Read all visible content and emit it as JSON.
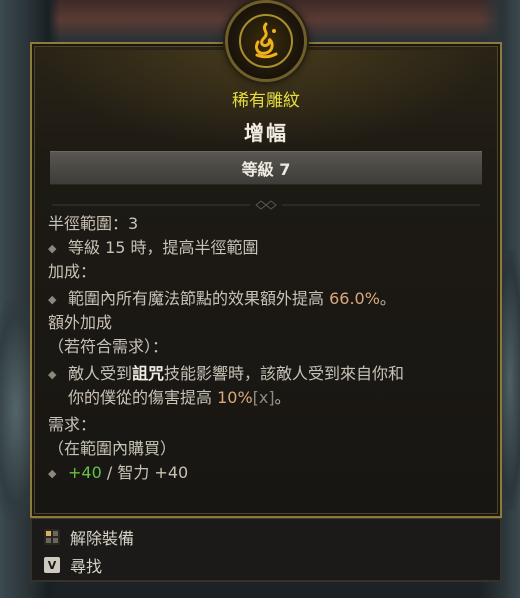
{
  "item": {
    "rarity": "稀有雕紋",
    "name": "增幅",
    "level_label": "等級 7"
  },
  "stats": {
    "radius_label": "半徑範圍：3",
    "radius_bullet": "等級 15 時，提高半徑範圍",
    "bonus_header": "加成：",
    "bonus_text_pre": "範圍內所有魔法節點的效果額外提高 ",
    "bonus_value": "66.0%",
    "bonus_text_post": "。",
    "extra_header": "額外加成",
    "extra_condition": "（若符合需求）：",
    "extra_line1_pre": "敵人受到",
    "extra_line1_bold": "詛咒",
    "extra_line1_post": "技能影響時，該敵人受到來自你和",
    "extra_line2_pre": "你的僕從的傷害提高 ",
    "extra_line2_value": "10%",
    "extra_line2_tag": "[x]",
    "extra_line2_post": "。",
    "req_header": "需求：",
    "req_condition": "（在範圍內購買）",
    "req_bonus_value": "+40",
    "req_bonus_text": " / 智力 +40"
  },
  "footer": {
    "unequip_label": "解除裝備",
    "find_key": "V",
    "find_label": "尋找"
  },
  "colors": {
    "rarity": "#e6dc3f",
    "highlight": "#d9a97d",
    "green": "#62c247",
    "border_gold": "#8e7a3c"
  }
}
